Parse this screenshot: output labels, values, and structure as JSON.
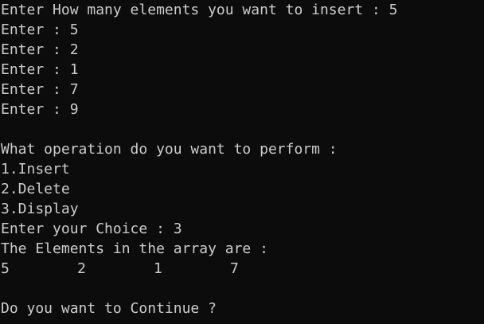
{
  "console": {
    "prompt_count": "Enter How many elements you want to insert : 5",
    "entries": [
      "Enter : 5",
      "Enter : 2",
      "Enter : 1",
      "Enter : 7",
      "Enter : 9"
    ],
    "menu": {
      "question": "What operation do you want to perform :",
      "options": [
        "1.Insert",
        "2.Delete",
        "3.Display"
      ]
    },
    "choice_prompt": "Enter your Choice : 3",
    "result_heading": "The Elements in the array are :",
    "array_values": [
      "5",
      "2",
      "1",
      "7"
    ],
    "continue_prompt": "Do you want to Continue ?"
  }
}
